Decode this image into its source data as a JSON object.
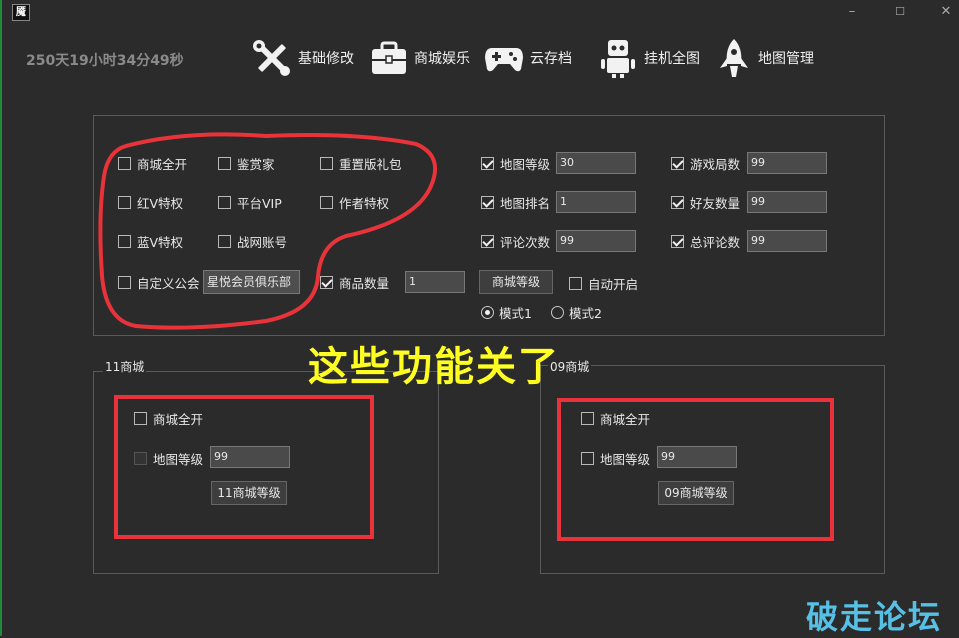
{
  "window": {
    "icon_text": "魇",
    "min_symbol": "–",
    "max_symbol": "☐",
    "close_symbol": "✕"
  },
  "header": {
    "timer": "250天19小时34分49秒",
    "nav": [
      {
        "label": "基础修改",
        "icon": "tools-icon"
      },
      {
        "label": "商城娱乐",
        "icon": "briefcase-icon"
      },
      {
        "label": "云存档",
        "icon": "gamepad-icon"
      },
      {
        "label": "挂机全图",
        "icon": "robot-icon"
      },
      {
        "label": "地图管理",
        "icon": "rocket-icon"
      }
    ]
  },
  "main": {
    "left_checks": [
      {
        "label": "商城全开",
        "checked": false
      },
      {
        "label": "鉴赏家",
        "checked": false
      },
      {
        "label": "重置版礼包",
        "checked": false
      },
      {
        "label": "红V特权",
        "checked": false
      },
      {
        "label": "平台VIP",
        "checked": false
      },
      {
        "label": "作者特权",
        "checked": false
      },
      {
        "label": "蓝V特权",
        "checked": false
      },
      {
        "label": "战网账号",
        "checked": false
      }
    ],
    "custom_guild": {
      "label": "自定义公会",
      "checked": false,
      "value": "星悦会员俱乐部"
    },
    "goods_count": {
      "label": "商品数量",
      "checked": true,
      "value": "1"
    },
    "shop_level_button": "商城等级",
    "auto_start": {
      "label": "自动开启",
      "checked": false
    },
    "modes": [
      {
        "label": "模式1",
        "selected": true
      },
      {
        "label": "模式2",
        "selected": false
      }
    ],
    "right_fields": [
      {
        "label": "地图等级",
        "checked": true,
        "value": "30"
      },
      {
        "label": "游戏局数",
        "checked": true,
        "value": "99"
      },
      {
        "label": "地图排名",
        "checked": true,
        "value": "1"
      },
      {
        "label": "好友数量",
        "checked": true,
        "value": "99"
      },
      {
        "label": "评论次数",
        "checked": true,
        "value": "99"
      },
      {
        "label": "总评论数",
        "checked": true,
        "value": "99"
      }
    ]
  },
  "shop11": {
    "title": "11商城",
    "open_all": {
      "label": "商城全开",
      "checked": false
    },
    "map_level": {
      "label": "地图等级",
      "value": "99"
    },
    "button": "11商城等级"
  },
  "shop09": {
    "title": "09商城",
    "open_all": {
      "label": "商城全开",
      "checked": false
    },
    "map_level": {
      "label": "地图等级",
      "value": "99"
    },
    "button": "09商城等级"
  },
  "annotation": "这些功能关了",
  "watermark": "破走论坛",
  "colors": {
    "background": "#2b2b2b",
    "annotation_red": "#e8333a",
    "annotation_yellow": "#ffff22",
    "watermark": "#5ac8f0"
  }
}
